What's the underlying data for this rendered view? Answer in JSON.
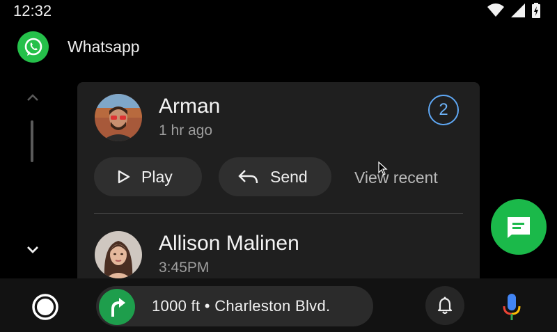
{
  "status_bar": {
    "time": "12:32",
    "icons": [
      "wifi-icon",
      "cellular-signal-icon",
      "battery-charging-icon"
    ]
  },
  "app": {
    "name": "Whatsapp",
    "icon": "whatsapp-icon",
    "brand_color": "#25C04A"
  },
  "conversations": [
    {
      "name": "Arman",
      "time": "1 hr ago",
      "unread_count": "2",
      "actions": {
        "play": "Play",
        "send": "Send",
        "view_recent": "View recent"
      }
    },
    {
      "name": "Allison Malinen",
      "time": "3:45PM"
    }
  ],
  "navigation": {
    "instruction": "1000 ft • Charleston Blvd.",
    "direction_icon": "turn-right-icon"
  },
  "colors": {
    "accent_blue": "#5FA8F5",
    "fab_green": "#1BB94A",
    "nav_green": "#1E9E4C"
  }
}
